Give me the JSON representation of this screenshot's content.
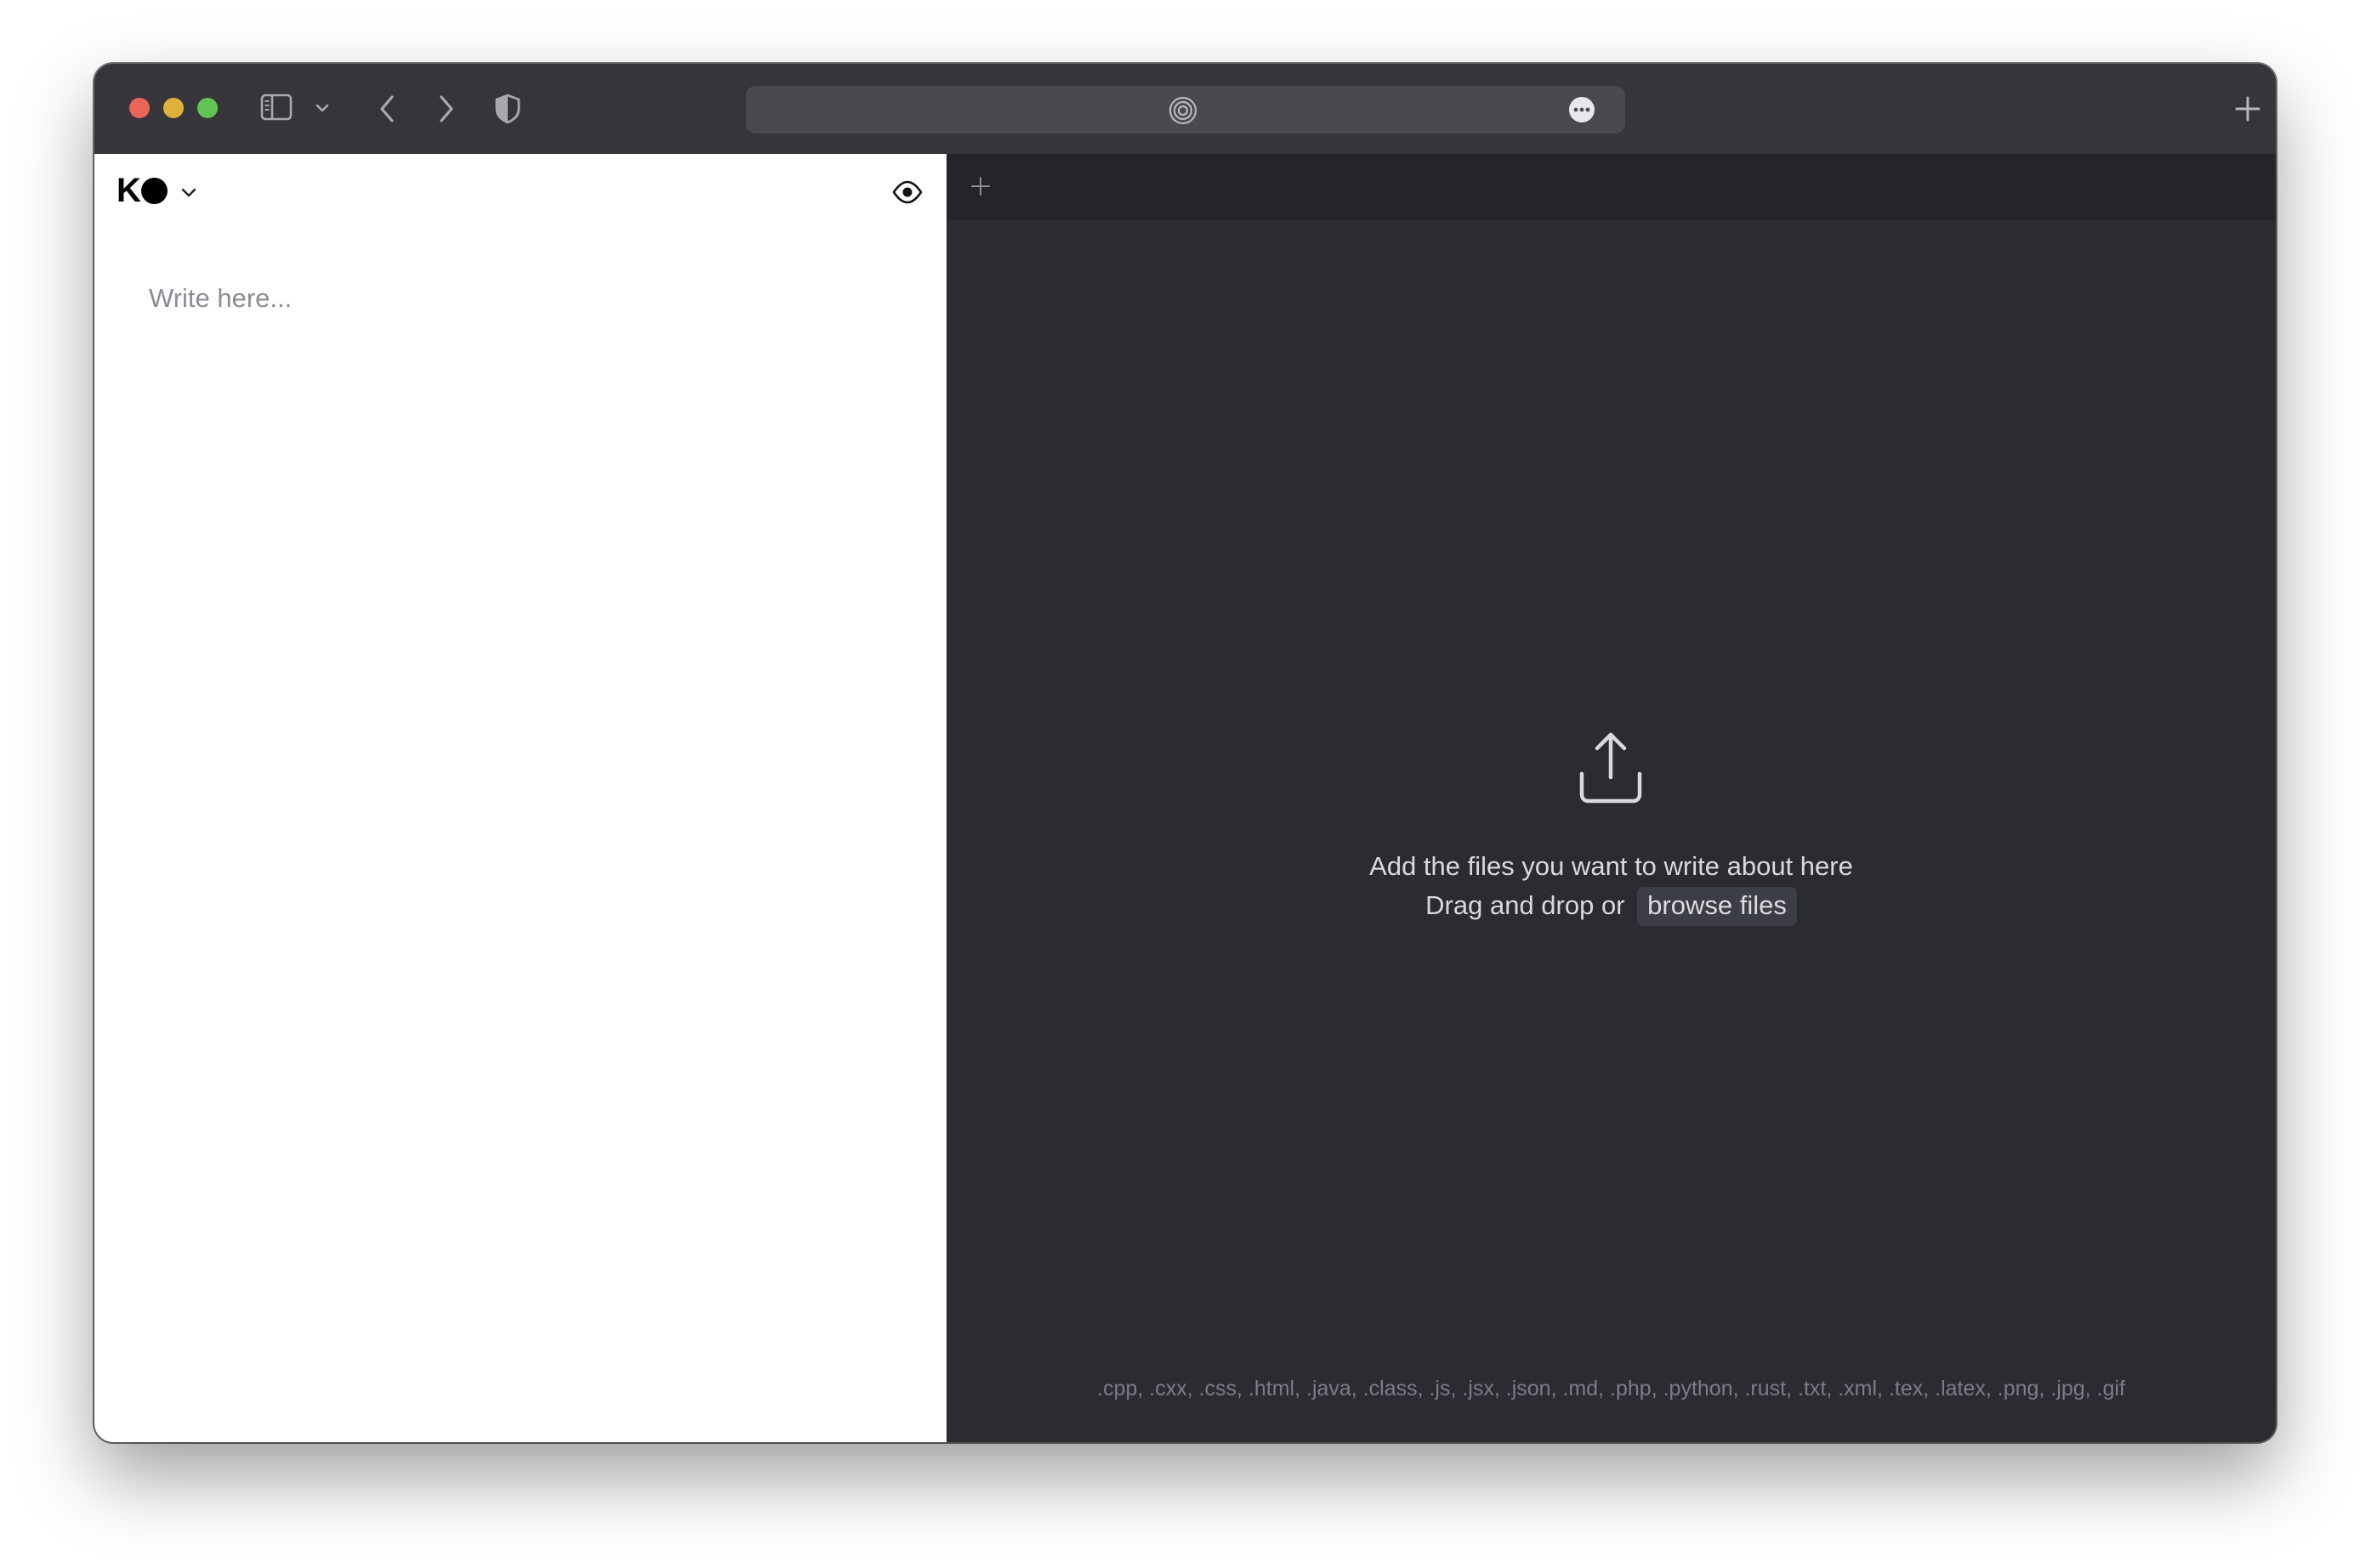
{
  "toolbar": {
    "icons": {
      "close": "close-dot",
      "minimize": "minimize-dot",
      "maximize": "maximize-dot",
      "sidebar": "sidebar-icon",
      "sidebar_menu": "chevron-down-icon",
      "back": "chevron-left-icon",
      "forward": "chevron-right-icon",
      "privacy": "shield-icon",
      "site": "target-icon",
      "page_menu": "ellipsis-circle-icon",
      "new_tab": "plus-icon"
    },
    "url": ""
  },
  "left_pane": {
    "logo_letter": "K",
    "logo_menu_icon": "chevron-down-icon",
    "preview_icon": "eye-icon",
    "editor_placeholder": "Write here..."
  },
  "right_pane": {
    "add_tab_icon": "plus-icon",
    "upload_icon": "upload-icon",
    "drop_title": "Add the files you want to write about here",
    "drop_prefix": "Drag and drop or",
    "browse_label": "browse files",
    "supported_types": ".cpp, .cxx, .css, .html, .java, .class, .js, .jsx, .json, .md, .php, .python, .rust, .txt, .xml, .tex, .latex, .png, .jpg, .gif"
  },
  "colors": {
    "toolbar_bg": "#36353a",
    "editor_bg": "#ffffff",
    "dropzone_bg": "#2a2c32",
    "tabs_bar_bg": "#24252a",
    "close": "#ec6559",
    "minimize": "#e0b23c",
    "maximize": "#61c454",
    "browse_bg": "#3c3e45"
  }
}
